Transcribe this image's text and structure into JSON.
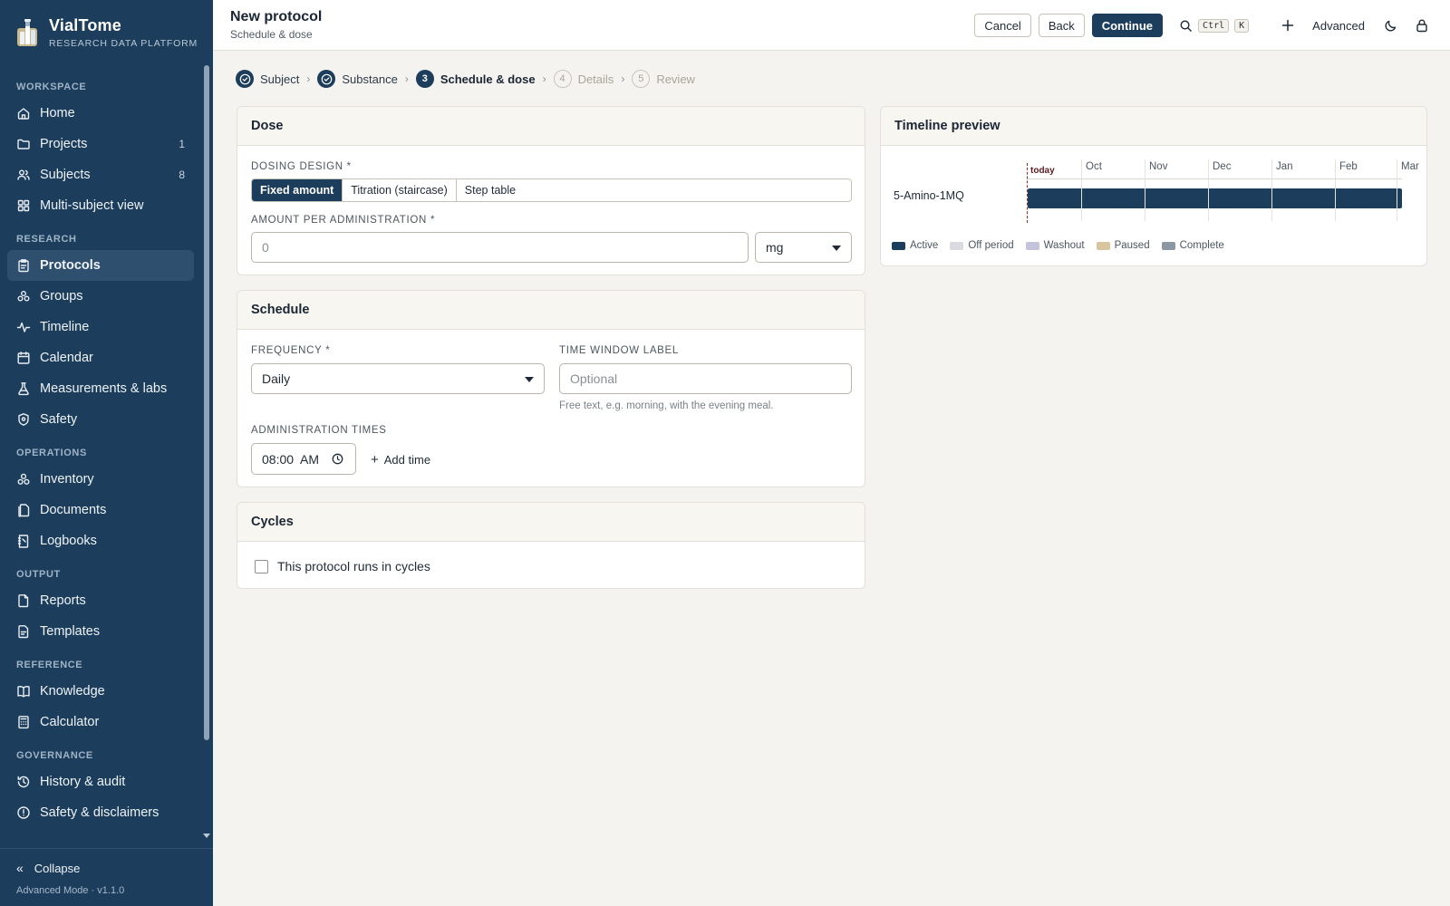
{
  "brand": {
    "name": "VialTome",
    "subtitle": "RESEARCH DATA PLATFORM"
  },
  "sidebar": {
    "sections": [
      {
        "title": "WORKSPACE",
        "items": [
          {
            "label": "Home",
            "icon": "home-icon"
          },
          {
            "label": "Projects",
            "icon": "folder-icon",
            "count": "1"
          },
          {
            "label": "Subjects",
            "icon": "users-icon",
            "count": "8"
          },
          {
            "label": "Multi-subject view",
            "icon": "grid-icon"
          }
        ]
      },
      {
        "title": "RESEARCH",
        "items": [
          {
            "label": "Protocols",
            "icon": "clipboard-icon",
            "active": true
          },
          {
            "label": "Groups",
            "icon": "groups-icon"
          },
          {
            "label": "Timeline",
            "icon": "activity-icon"
          },
          {
            "label": "Calendar",
            "icon": "calendar-icon"
          },
          {
            "label": "Measurements & labs",
            "icon": "flask-icon"
          },
          {
            "label": "Safety",
            "icon": "shield-icon"
          }
        ]
      },
      {
        "title": "OPERATIONS",
        "items": [
          {
            "label": "Inventory",
            "icon": "boxes-icon"
          },
          {
            "label": "Documents",
            "icon": "documents-icon"
          },
          {
            "label": "Logbooks",
            "icon": "logbook-icon"
          }
        ]
      },
      {
        "title": "OUTPUT",
        "items": [
          {
            "label": "Reports",
            "icon": "report-icon"
          },
          {
            "label": "Templates",
            "icon": "template-icon"
          }
        ]
      },
      {
        "title": "REFERENCE",
        "items": [
          {
            "label": "Knowledge",
            "icon": "book-icon"
          },
          {
            "label": "Calculator",
            "icon": "calculator-icon"
          }
        ]
      },
      {
        "title": "GOVERNANCE",
        "items": [
          {
            "label": "History & audit",
            "icon": "history-icon"
          },
          {
            "label": "Safety & disclaimers",
            "icon": "alert-circle-icon"
          }
        ]
      }
    ],
    "collapse_label": "Collapse",
    "version": "Advanced Mode · v1.1.0"
  },
  "header": {
    "title": "New protocol",
    "subtitle": "Schedule & dose",
    "cancel_label": "Cancel",
    "back_label": "Back",
    "continue_label": "Continue",
    "shortcut_key1": "Ctrl",
    "shortcut_key2": "K",
    "advanced_label": "Advanced"
  },
  "stepper": {
    "steps": [
      {
        "num": "1",
        "label": "Subject",
        "state": "done"
      },
      {
        "num": "2",
        "label": "Substance",
        "state": "done"
      },
      {
        "num": "3",
        "label": "Schedule & dose",
        "state": "current"
      },
      {
        "num": "4",
        "label": "Details",
        "state": "todo"
      },
      {
        "num": "5",
        "label": "Review",
        "state": "todo"
      }
    ]
  },
  "dose": {
    "title": "Dose",
    "design_label": "DOSING DESIGN *",
    "design_options": [
      "Fixed amount",
      "Titration (staircase)",
      "Step table"
    ],
    "design_selected": "Fixed amount",
    "amount_label": "AMOUNT PER ADMINISTRATION *",
    "amount_placeholder": "0",
    "unit_value": "mg"
  },
  "schedule": {
    "title": "Schedule",
    "frequency_label": "FREQUENCY *",
    "frequency_value": "Daily",
    "window_label": "TIME WINDOW LABEL",
    "window_placeholder": "Optional",
    "window_hint": "Free text, e.g. morning, with the evening meal.",
    "times_label": "ADMINISTRATION TIMES",
    "time_value": "08:00  AM",
    "add_time_label": "Add time"
  },
  "cycles": {
    "title": "Cycles",
    "checkbox_label": "This protocol runs in cycles",
    "checked": false
  },
  "timeline": {
    "title": "Timeline preview",
    "today_label": "today",
    "months": [
      "Oct",
      "Nov",
      "Dec",
      "Jan",
      "Feb",
      "Mar"
    ],
    "row_label": "5-Amino-1MQ",
    "legend": [
      {
        "label": "Active",
        "color": "#1c3d5c"
      },
      {
        "label": "Off period",
        "color": "#d9dbe0"
      },
      {
        "label": "Washout",
        "color": "#c3c3dc"
      },
      {
        "label": "Paused",
        "color": "#d8c5a0"
      },
      {
        "label": "Complete",
        "color": "#8c97a4"
      }
    ]
  }
}
